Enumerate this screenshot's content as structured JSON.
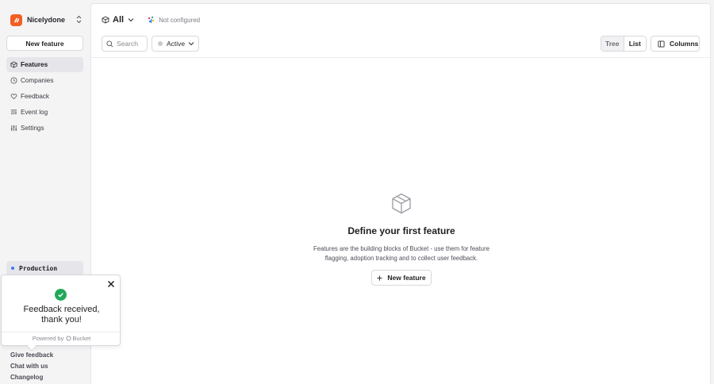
{
  "org": {
    "name": "Nicelydone"
  },
  "sidebar": {
    "new_feature_label": "New feature",
    "items": [
      {
        "label": "Features",
        "icon": "cube-icon",
        "active": true
      },
      {
        "label": "Companies",
        "icon": "clock-icon",
        "active": false
      },
      {
        "label": "Feedback",
        "icon": "heart-icon",
        "active": false
      },
      {
        "label": "Event log",
        "icon": "list-icon",
        "active": false
      },
      {
        "label": "Settings",
        "icon": "sliders-icon",
        "active": false
      }
    ],
    "environment": "Production",
    "footer": [
      "Give feedback",
      "Chat with us",
      "Changelog"
    ]
  },
  "popup": {
    "message_line1": "Feedback received,",
    "message_line2": "thank you!",
    "powered_prefix": "Powered by",
    "powered_brand": "Bucket"
  },
  "header": {
    "env_filter": "All",
    "config_status": "Not configured"
  },
  "toolbar": {
    "search_placeholder": "Search",
    "status_filter": "Active",
    "view_tree": "Tree",
    "view_list": "List",
    "columns_label": "Columns"
  },
  "empty_state": {
    "title": "Define your first feature",
    "description": "Features are the building blocks of Bucket - use them for feature flagging, adoption tracking and to collect user feedback.",
    "cta": "New feature"
  },
  "colors": {
    "brand": "#f25f22",
    "success": "#23a85a",
    "env_dot": "#3e7cf0"
  }
}
